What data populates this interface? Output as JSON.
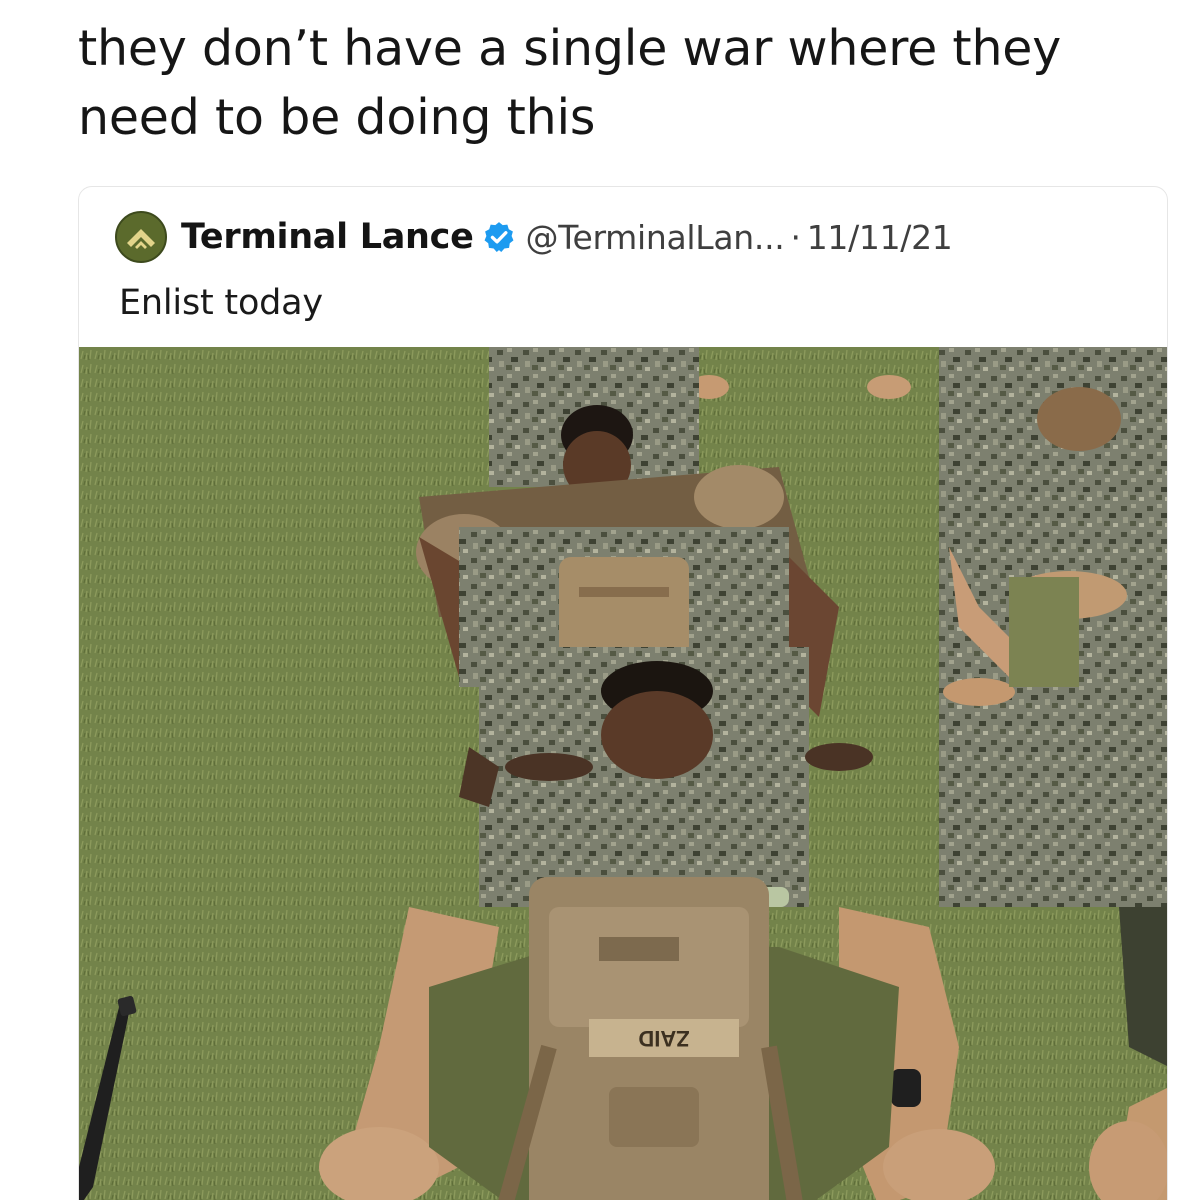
{
  "post": {
    "caption": "they don’t have a single war where they need to be doing this"
  },
  "tweet": {
    "display_name": "Terminal Lance",
    "verified_icon": "verified-badge-icon",
    "handle": "@TerminalLan...",
    "separator": "·",
    "date": "11/11/21",
    "text": "Enlist today",
    "avatar_icon": "lance-corporal-chevron-icon",
    "colors": {
      "verified": "#1d9bf0",
      "avatar": "#5b6a2c"
    }
  },
  "photo": {
    "name_tape": "ZAID"
  }
}
